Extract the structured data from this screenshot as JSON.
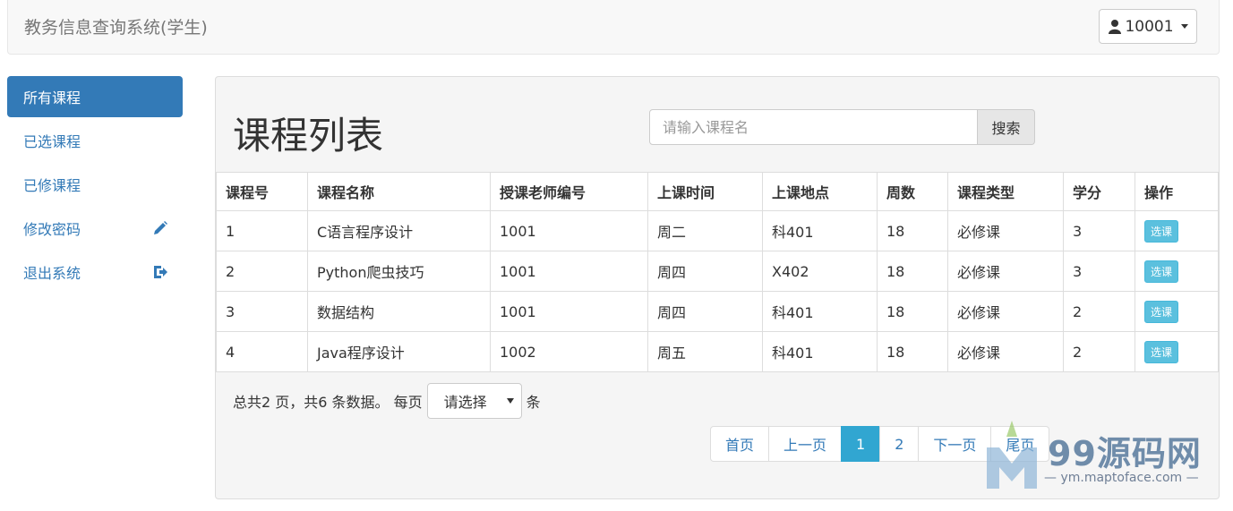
{
  "app": {
    "title": "教务信息查询系统(学生)",
    "user": "10001"
  },
  "sidebar": {
    "items": [
      {
        "label": "所有课程",
        "active": true
      },
      {
        "label": "已选课程"
      },
      {
        "label": "已修课程"
      },
      {
        "label": "修改密码",
        "icon": "pencil-icon"
      },
      {
        "label": "退出系统",
        "icon": "logout-icon"
      }
    ]
  },
  "main": {
    "title": "课程列表",
    "search": {
      "placeholder": "请输入课程名",
      "button": "搜索"
    },
    "table": {
      "headers": [
        "课程号",
        "课程名称",
        "授课老师编号",
        "上课时间",
        "上课地点",
        "周数",
        "课程类型",
        "学分",
        "操作"
      ],
      "rows": [
        [
          "1",
          "C语言程序设计",
          "1001",
          "周二",
          "科401",
          "18",
          "必修课",
          "3",
          "选课"
        ],
        [
          "2",
          "Python爬虫技巧",
          "1001",
          "周四",
          "X402",
          "18",
          "必修课",
          "3",
          "选课"
        ],
        [
          "3",
          "数据结构",
          "1001",
          "周四",
          "科401",
          "18",
          "必修课",
          "2",
          "选课"
        ],
        [
          "4",
          "Java程序设计",
          "1002",
          "周五",
          "科401",
          "18",
          "必修课",
          "2",
          "选课"
        ]
      ]
    },
    "summary": {
      "text": "总共2 页，共6 条数据。 每页",
      "select": "请选择",
      "suffix": "条"
    },
    "pager": [
      "首页",
      "上一页",
      "1",
      "2",
      "下一页",
      "尾页"
    ]
  },
  "watermark": {
    "text": "99源码网",
    "sub": "— ym.maptoface.com —"
  }
}
